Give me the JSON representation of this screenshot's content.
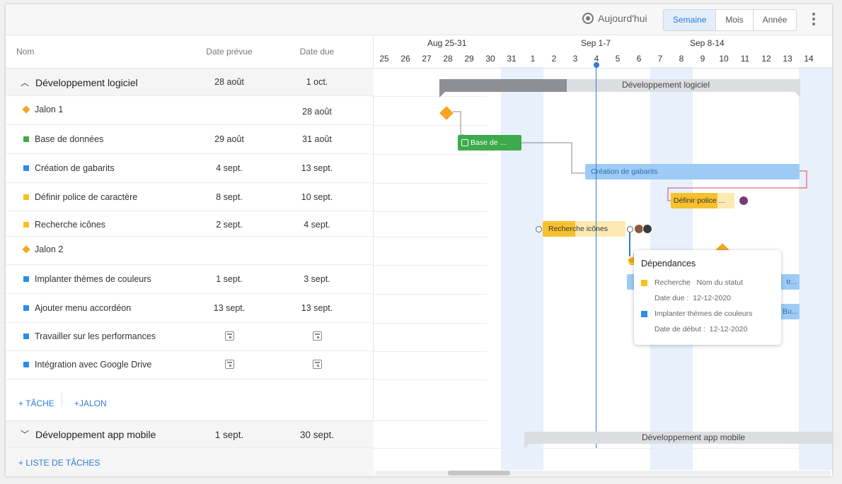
{
  "toolbar": {
    "today_label": "Aujourd'hui",
    "views": [
      "Semaine",
      "Mois",
      "Année"
    ],
    "active_view": "Semaine"
  },
  "columns": {
    "name": "Nom",
    "planned": "Date prévue",
    "due": "Date due"
  },
  "group1": {
    "title": "Développement logiciel",
    "planned": "28 août",
    "due": "1 oct."
  },
  "tasks": [
    {
      "name": "Jalon 1",
      "planned": "",
      "due": "28 août",
      "kind": "milestone",
      "color": "#f5a623"
    },
    {
      "name": "Base de données",
      "planned": "29 août",
      "due": "31 août",
      "kind": "task",
      "color": "#3daa4c"
    },
    {
      "name": "Création de gabarits",
      "planned": "4 sept.",
      "due": "13 sept.",
      "kind": "task",
      "color": "#2a8de6"
    },
    {
      "name": "Définir police de caractère",
      "planned": "8 sept.",
      "due": "10 sept.",
      "kind": "task",
      "color": "#f5c21b"
    },
    {
      "name": "Recherche icônes",
      "planned": "2 sept.",
      "due": "4 sept.",
      "kind": "task",
      "color": "#f5c21b"
    },
    {
      "name": "Jalon 2",
      "planned": "",
      "due": "",
      "kind": "milestone",
      "color": "#f5a623"
    },
    {
      "name": "Implanter thèmes de couleurs",
      "planned": "1 sept.",
      "due": "3 sept.",
      "kind": "task",
      "color": "#2a8de6"
    },
    {
      "name": "Ajouter menu accordéon",
      "planned": "13 sept.",
      "due": "13 sept.",
      "kind": "task",
      "color": "#2a8de6"
    },
    {
      "name": "Travailler sur les performances",
      "planned": "",
      "due": "",
      "kind": "task",
      "color": "#2a8de6"
    },
    {
      "name": "Intégration avec Google Drive",
      "planned": "",
      "due": "",
      "kind": "task",
      "color": "#2a8de6"
    }
  ],
  "actions": {
    "add_task": "+ TÂCHE",
    "add_milestone": "+JALON",
    "add_list": "+ LISTE DE TÂCHES"
  },
  "group2": {
    "title": "Développement app mobile",
    "planned": "1 sept.",
    "due": "30 sept."
  },
  "timeline": {
    "weeks": [
      "Aug 25-31",
      "Sep 1-7",
      "Sep 8-14"
    ],
    "days": [
      "25",
      "26",
      "27",
      "28",
      "29",
      "30",
      "31",
      "1",
      "2",
      "3",
      "4",
      "5",
      "6",
      "7",
      "8",
      "9",
      "10",
      "11",
      "12",
      "13",
      "14"
    ]
  },
  "bars": {
    "group1": "Développement logiciel",
    "db": "Base de ...",
    "templates": "Création de gabarits",
    "font": "Définir police ...",
    "icons": "Recherche icônes",
    "b1": "tr...",
    "b2": "Bu...",
    "group2": "Développement app mobile"
  },
  "popup": {
    "title": "Dépendances",
    "item1_name": "Recherche",
    "item1_status": "Nom du statut",
    "item1_date_label": "Date due :",
    "item1_date": "12-12-2020",
    "item2_name": "Implanter thèmes de couleurs",
    "item2_date_label": "Date de début :",
    "item2_date": "12-12-2020"
  },
  "colors": {
    "accent": "#2f7bd6",
    "week_band": "#e7f0fb",
    "group_bar": "#dcdde1",
    "milestone": "#f5a623"
  }
}
